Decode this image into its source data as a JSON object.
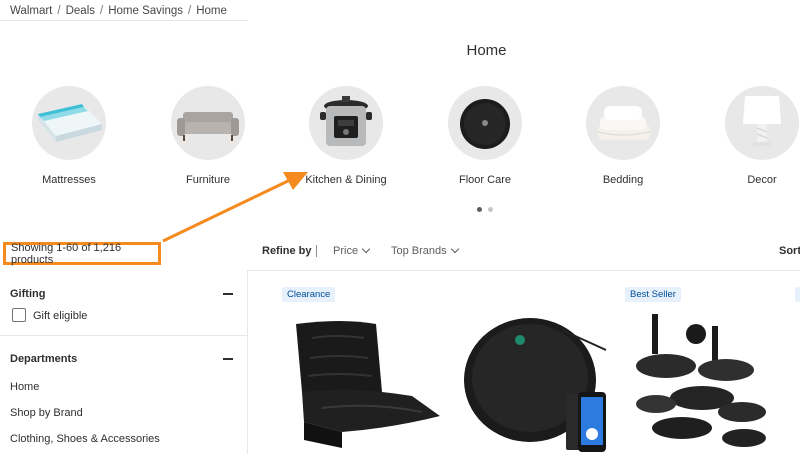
{
  "breadcrumb": [
    "Walmart",
    "Deals",
    "Home Savings",
    "Home"
  ],
  "breadcrumb_separator": "/",
  "page_title": "Home",
  "categories": [
    {
      "label": "Mattresses",
      "icon": "mattress-image"
    },
    {
      "label": "Furniture",
      "icon": "sofa-image"
    },
    {
      "label": "Kitchen & Dining",
      "icon": "pressure-cooker-image"
    },
    {
      "label": "Floor Care",
      "icon": "robot-vacuum-image"
    },
    {
      "label": "Bedding",
      "icon": "pillows-image"
    },
    {
      "label": "Decor",
      "icon": "lamp-image"
    }
  ],
  "carousel": {
    "pages": 2,
    "active": 1
  },
  "results": {
    "count_text": "Showing 1-60 of 1,216 products"
  },
  "toolbar": {
    "refine_label": "Refine by",
    "separator": "|",
    "filters": [
      "Price",
      "Top Brands"
    ],
    "sort_label": "Sort"
  },
  "sidebar": {
    "gifting": {
      "title": "Gifting",
      "option": "Gift eligible",
      "checked": false
    },
    "departments": {
      "title": "Departments",
      "items": [
        "Home",
        "Shop by Brand",
        "Clothing, Shoes & Accessories"
      ]
    }
  },
  "products": [
    {
      "badge": "Clearance",
      "image": "floor-gaming-chair-image"
    },
    {
      "badge": "",
      "image": "robot-vacuum-image"
    },
    {
      "badge": "Best Seller",
      "image": "cookware-set-image"
    }
  ],
  "colors": {
    "annotation": "#f58a1f",
    "badge_text": "#004f9a",
    "badge_bg": "#e6f1fc",
    "category_circle": "#e8e8e9"
  }
}
